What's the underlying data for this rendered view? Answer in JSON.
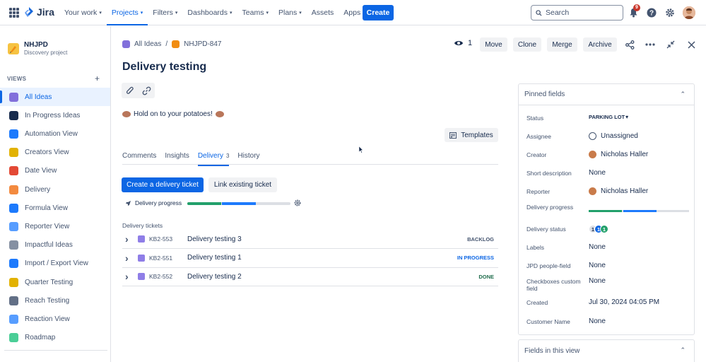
{
  "app": {
    "name": "Jira"
  },
  "nav": {
    "items": [
      {
        "label": "Your work",
        "dropdown": true
      },
      {
        "label": "Projects",
        "dropdown": true,
        "active": true
      },
      {
        "label": "Filters",
        "dropdown": true
      },
      {
        "label": "Dashboards",
        "dropdown": true
      },
      {
        "label": "Teams",
        "dropdown": true
      },
      {
        "label": "Plans",
        "dropdown": true
      },
      {
        "label": "Assets",
        "dropdown": false
      },
      {
        "label": "Apps",
        "dropdown": true
      }
    ],
    "create_label": "Create",
    "search_placeholder": "Search",
    "notifications_count": "9"
  },
  "sidebar": {
    "project_name": "NHJPD",
    "project_type": "Discovery project",
    "views_label": "VIEWS",
    "items": [
      {
        "label": "All Ideas",
        "icon": "crystal-ball-icon",
        "color": "#8270db",
        "active": true
      },
      {
        "label": "In Progress Ideas",
        "icon": "soon-icon",
        "color": "#172b4d"
      },
      {
        "label": "Automation View",
        "icon": "loop-icon",
        "color": "#1d7afc"
      },
      {
        "label": "Creators View",
        "icon": "person-icon",
        "color": "#e2b203"
      },
      {
        "label": "Date View",
        "icon": "calendar-icon",
        "color": "#e34935"
      },
      {
        "label": "Delivery",
        "icon": "truck-icon",
        "color": "#f38a3f"
      },
      {
        "label": "Formula View",
        "icon": "numbers-icon",
        "color": "#1d7afc"
      },
      {
        "label": "Reporter View",
        "icon": "syringe-icon",
        "color": "#579dff"
      },
      {
        "label": "Impactful Ideas",
        "icon": "chart-icon",
        "color": "#8590a2"
      },
      {
        "label": "Import / Export View",
        "icon": "arrows-icon",
        "color": "#1d7afc"
      },
      {
        "label": "Quarter Testing",
        "icon": "runner-icon",
        "color": "#e2b203"
      },
      {
        "label": "Reach Testing",
        "icon": "satellite-icon",
        "color": "#626f86"
      },
      {
        "label": "Reaction View",
        "icon": "landscape-icon",
        "color": "#579dff"
      },
      {
        "label": "Roadmap",
        "icon": "map-icon",
        "color": "#4bce97"
      }
    ]
  },
  "breadcrumb": {
    "parent": "All Ideas",
    "current": "NHJPD-847"
  },
  "issue": {
    "title": "Delivery testing",
    "watch_count": "1",
    "actions": [
      "Move",
      "Clone",
      "Merge",
      "Archive"
    ],
    "description": "Hold on to your potatoes!",
    "templates_label": "Templates"
  },
  "tabs": [
    {
      "label": "Comments"
    },
    {
      "label": "Insights"
    },
    {
      "label": "Delivery",
      "count": "3",
      "active": true
    },
    {
      "label": "History"
    }
  ],
  "delivery": {
    "create_button": "Create a delivery ticket",
    "link_button": "Link existing ticket",
    "progress_label": "Delivery progress",
    "progress": {
      "done": 0.33,
      "in_progress": 0.33
    },
    "tickets_label": "Delivery tickets",
    "tickets": [
      {
        "key": "KB2-553",
        "summary": "Delivery testing 3",
        "status": "BACKLOG",
        "status_color": "#44546f",
        "status_bg": "#ffffff"
      },
      {
        "key": "KB2-551",
        "summary": "Delivery testing 1",
        "status": "IN PROGRESS",
        "status_color": "#0c66e4",
        "status_bg": "#ffffff"
      },
      {
        "key": "KB2-552",
        "summary": "Delivery testing 2",
        "status": "DONE",
        "status_color": "#216e4e",
        "status_bg": "#ffffff"
      }
    ]
  },
  "pinned": {
    "header": "Pinned fields",
    "fields": [
      {
        "label": "Status",
        "value": "PARKING LOT"
      },
      {
        "label": "Assignee",
        "value": "Unassigned"
      },
      {
        "label": "Creator",
        "value": "Nicholas Haller"
      },
      {
        "label": "Short description",
        "value": "None"
      },
      {
        "label": "Reporter",
        "value": "Nicholas Haller"
      },
      {
        "label": "Delivery progress",
        "value": ""
      },
      {
        "label": "Delivery status",
        "value": ""
      },
      {
        "label": "Labels",
        "value": "None"
      },
      {
        "label": "JPD people-field",
        "value": "None"
      },
      {
        "label": "Checkboxes custom field",
        "value": "None"
      },
      {
        "label": "Created",
        "value": "Jul 30, 2024 04:05 PM"
      },
      {
        "label": "Customer Name",
        "value": "None"
      }
    ],
    "delivery_status_counts": [
      {
        "n": "1",
        "color": "#dcdfe4",
        "text": "#172b4d"
      },
      {
        "n": "1",
        "color": "#0c66e4",
        "text": "#ffffff"
      },
      {
        "n": "1",
        "color": "#22a06b",
        "text": "#ffffff"
      }
    ]
  },
  "fields_in_view_header": "Fields in this view"
}
